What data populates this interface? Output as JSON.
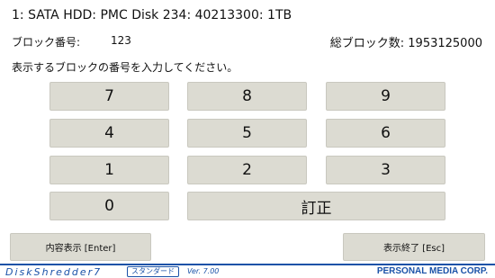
{
  "header": {
    "disk_title": "1: SATA HDD: PMC Disk 234: 40213300: 1TB",
    "block_label": "ブロック番号:",
    "block_value": "123",
    "total_blocks": "総ブロック数: 1953125000",
    "instruction": "表示するブロックの番号を入力してください。"
  },
  "keypad": {
    "k7": "7",
    "k8": "8",
    "k9": "9",
    "k4": "4",
    "k5": "5",
    "k6": "6",
    "k1": "1",
    "k2": "2",
    "k3": "3",
    "k0": "0",
    "correct": "訂正"
  },
  "actions": {
    "show_content": "内容表示 [Enter]",
    "exit_display": "表示終了 [Esc]"
  },
  "footer": {
    "logo": "DiskShredder7",
    "badge": "スタンダード",
    "version": "Ver. 7.00",
    "company": "PERSONAL MEDIA CORP."
  },
  "colors": {
    "accent": "#1a52a8",
    "key_bg": "#dcdbd2"
  }
}
